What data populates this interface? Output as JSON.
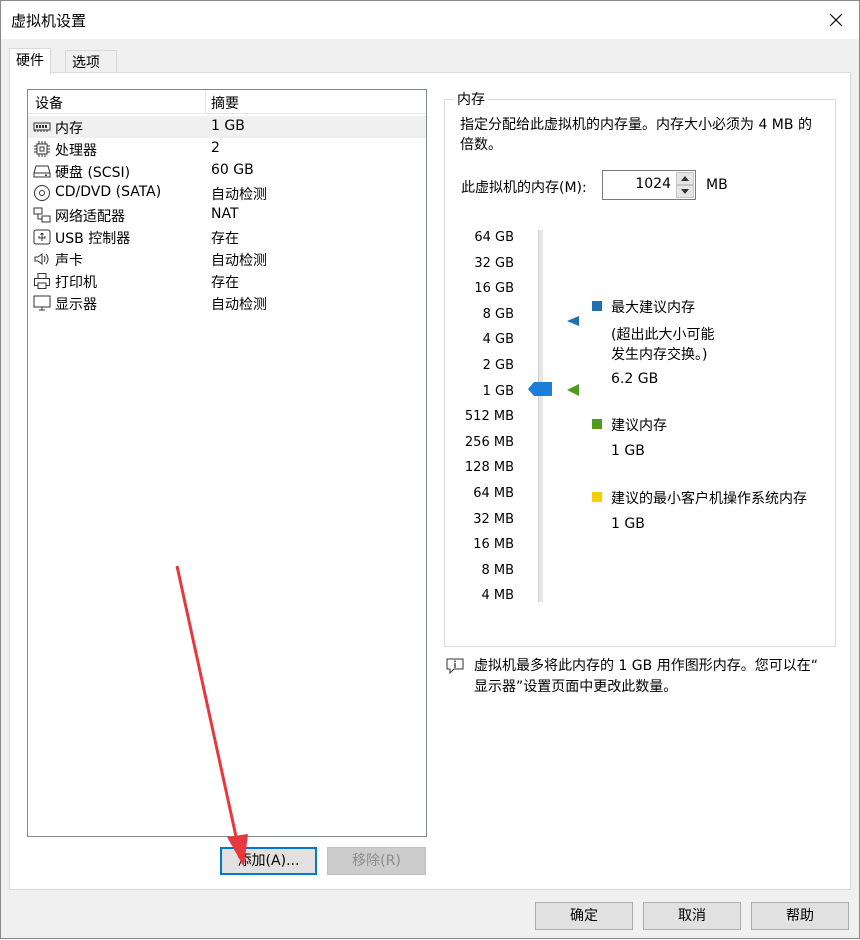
{
  "window": {
    "title": "虚拟机设置"
  },
  "tabs": [
    {
      "label": "硬件"
    },
    {
      "label": "选项"
    }
  ],
  "device_list": {
    "headers": {
      "device": "设备",
      "summary": "摘要"
    },
    "rows": [
      {
        "name": "内存",
        "summary": "1 GB",
        "icon": "memory-icon"
      },
      {
        "name": "处理器",
        "summary": "2",
        "icon": "processor-icon"
      },
      {
        "name": "硬盘 (SCSI)",
        "summary": "60 GB",
        "icon": "harddisk-icon"
      },
      {
        "name": "CD/DVD (SATA)",
        "summary": "自动检测",
        "icon": "cdrom-icon"
      },
      {
        "name": "网络适配器",
        "summary": "NAT",
        "icon": "network-icon"
      },
      {
        "name": "USB 控制器",
        "summary": "存在",
        "icon": "usb-icon"
      },
      {
        "name": "声卡",
        "summary": "自动检测",
        "icon": "speaker-icon"
      },
      {
        "name": "打印机",
        "summary": "存在",
        "icon": "printer-icon"
      },
      {
        "name": "显示器",
        "summary": "自动检测",
        "icon": "monitor-icon"
      }
    ],
    "add_button": "添加(A)...",
    "remove_button": "移除(R)"
  },
  "memory": {
    "legend": "内存",
    "description": "指定分配给此虚拟机的内存量。内存大小必须为 4 MB 的倍数。",
    "label": "此虚拟机的内存(M):",
    "value": "1024",
    "unit": "MB",
    "scale": [
      "64 GB",
      "32 GB",
      "16 GB",
      "8 GB",
      "4 GB",
      "2 GB",
      "1 GB",
      "512 MB",
      "256 MB",
      "128 MB",
      "64 MB",
      "32 MB",
      "16 MB",
      "8 MB",
      "4 MB"
    ],
    "legend_items": {
      "max": {
        "title": "最大建议内存",
        "note_line1": "(超出此大小可能",
        "note_line2": "发生内存交换。)",
        "value": "6.2 GB",
        "color": "#1f6fb4"
      },
      "recommended": {
        "title": "建议内存",
        "value": "1 GB",
        "color": "#4f9a1f"
      },
      "min_guest": {
        "title": "建议的最小客户机操作系统内存",
        "value": "1 GB",
        "color": "#f4d000"
      }
    },
    "info_line1": "虚拟机最多将此内存的 1 GB 用作图形内存。您可以在“",
    "info_line2": "显示器”设置页面中更改此数量。"
  },
  "footer": {
    "ok": "确定",
    "cancel": "取消",
    "help": "帮助"
  },
  "colors": {
    "accent": "#0078d7",
    "slider_thumb": "#1c7ed6",
    "annotation_arrow": "#e8383d"
  }
}
